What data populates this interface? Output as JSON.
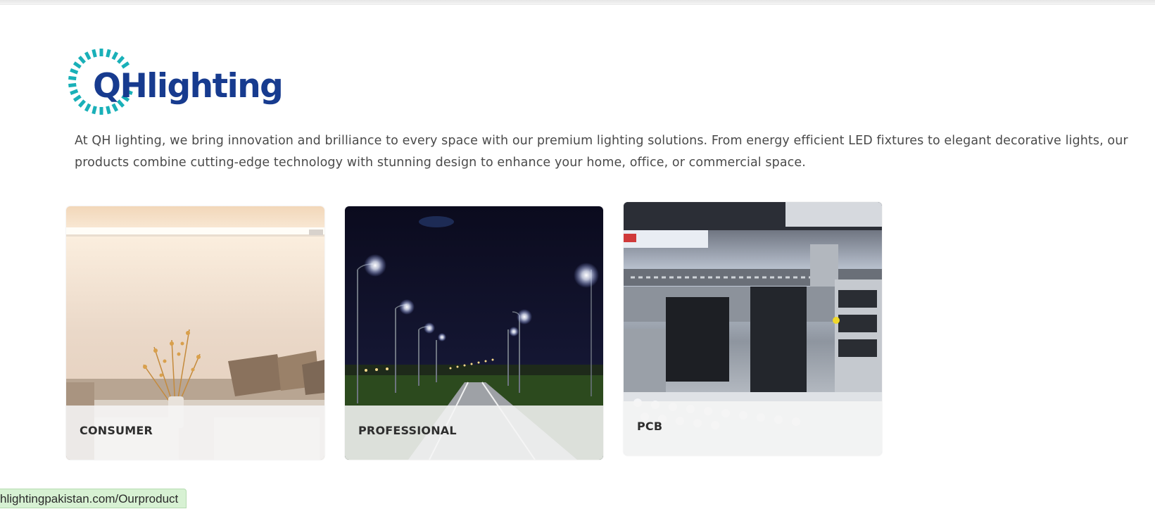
{
  "logo": {
    "text": "QHlighting",
    "colors": {
      "text": "#173b8f",
      "mark": "#19b0b8"
    }
  },
  "intro": {
    "line1": "At QH lighting, we bring innovation and brilliance to every space with our premium lighting solutions. From energy efficient LED fixtures to elegant decorative lights, our",
    "line2": "products combine cutting-edge technology with stunning design to enhance your home, office, or commercial space."
  },
  "categories": [
    {
      "label": "CONSUMER",
      "image": "living-room-with-led-strip"
    },
    {
      "label": "PROFESSIONAL",
      "image": "street-lights-on-highway-at-night"
    },
    {
      "label": "PCB",
      "image": "pcb-assembly-machine"
    }
  ],
  "status_bar": {
    "url": "hlightingpakistan.com/Ourproduct"
  }
}
